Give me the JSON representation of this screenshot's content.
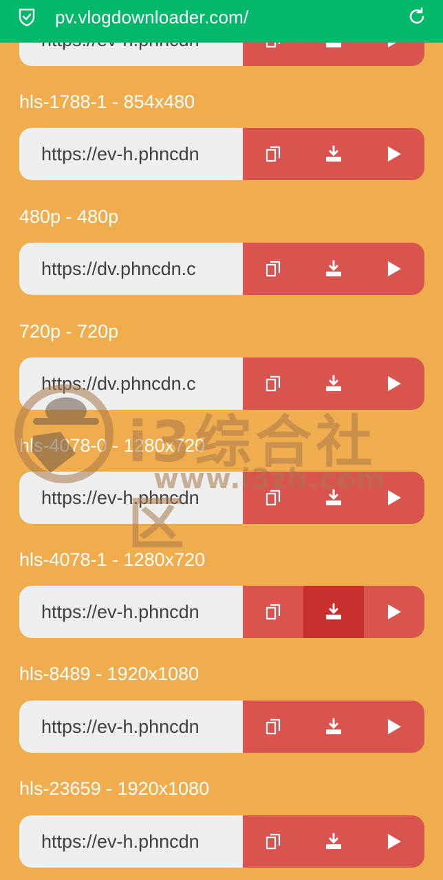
{
  "browser": {
    "url": "pv.vlogdownloader.com/"
  },
  "entries": [
    {
      "label": "",
      "url": "https://ev-h.phncdn"
    },
    {
      "label": "hls-1788-1 - 854x480",
      "url": "https://ev-h.phncdn"
    },
    {
      "label": "480p - 480p",
      "url": "https://dv.phncdn.c"
    },
    {
      "label": "720p - 720p",
      "url": "https://dv.phncdn.c"
    },
    {
      "label": "hls-4078-0 - 1280x720",
      "url": "https://ev-h.phncdn"
    },
    {
      "label": "hls-4078-1 - 1280x720",
      "url": "https://ev-h.phncdn"
    },
    {
      "label": "hls-8489 - 1920x1080",
      "url": "https://ev-h.phncdn"
    },
    {
      "label": "hls-23659 - 1920x1080",
      "url": "https://ev-h.phncdn"
    }
  ],
  "watermark": {
    "title": "i3综合社区",
    "url": "www.i3zh.com"
  },
  "colors": {
    "page_bg": "#F0AD4E",
    "urlbar_bg": "#02B96B",
    "button_red": "#D9534F",
    "button_active": "#C9302C",
    "input_bg": "#ECEEF0"
  },
  "icons": {
    "copy": "copy-icon",
    "download": "download-icon",
    "play": "play-icon"
  }
}
